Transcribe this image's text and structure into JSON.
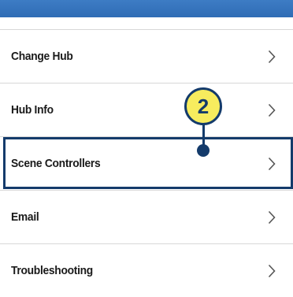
{
  "menu": {
    "items": [
      {
        "label": "Change Hub"
      },
      {
        "label": "Hub Info"
      },
      {
        "label": "Scene Controllers"
      },
      {
        "label": "Email"
      },
      {
        "label": "Troubleshooting"
      }
    ]
  },
  "callout": {
    "number": "2"
  },
  "colors": {
    "header": "#2f6cb5",
    "callout_fill": "#f7ec5e",
    "callout_border": "#143b6b",
    "highlight_border": "#143b6b"
  },
  "icons": {
    "chevron": "chevron-right-icon"
  }
}
